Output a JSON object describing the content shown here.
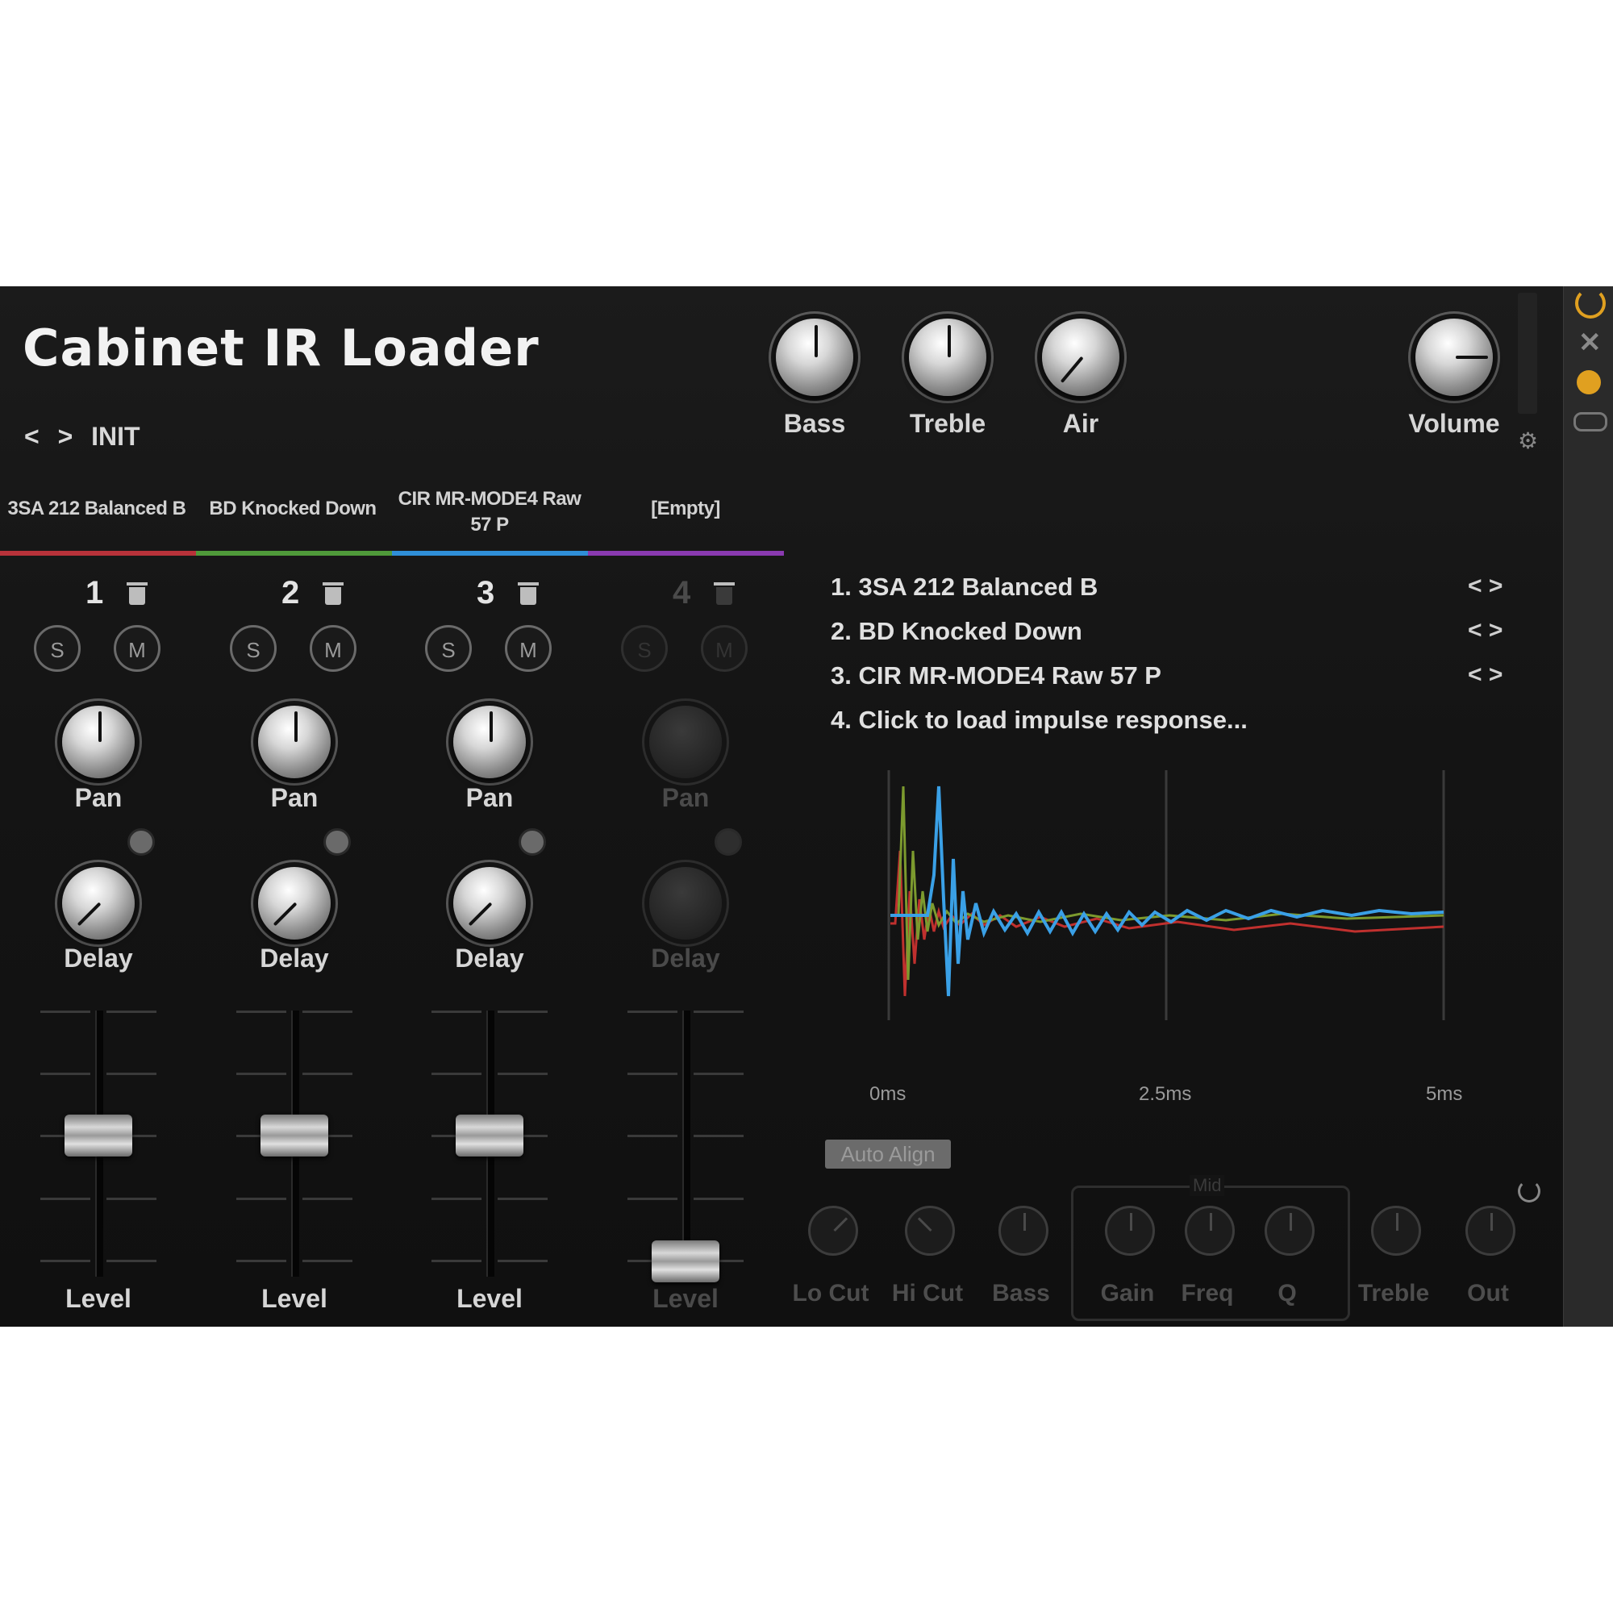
{
  "header": {
    "title": "Cabinet IR Loader",
    "preset_prev": "<",
    "preset_next": ">",
    "preset_name": "INIT"
  },
  "master_knobs": [
    {
      "label": "Bass"
    },
    {
      "label": "Treble"
    },
    {
      "label": "Air"
    },
    {
      "label": "Volume"
    }
  ],
  "tabs": [
    {
      "label": "3SA 212 Balanced B",
      "color": "#b8323a"
    },
    {
      "label": "BD Knocked Down",
      "color": "#4f9a3a"
    },
    {
      "label": "CIR MR-MODE4 Raw 57 P",
      "color": "#2f8fd8"
    },
    {
      "label": "[Empty]",
      "color": "#8a3ab0"
    }
  ],
  "channels": [
    {
      "number": "1",
      "solo": "S",
      "mute": "M",
      "pan": "Pan",
      "delay": "Delay",
      "level": "Level"
    },
    {
      "number": "2",
      "solo": "S",
      "mute": "M",
      "pan": "Pan",
      "delay": "Delay",
      "level": "Level"
    },
    {
      "number": "3",
      "solo": "S",
      "mute": "M",
      "pan": "Pan",
      "delay": "Delay",
      "level": "Level"
    },
    {
      "number": "4",
      "solo": "S",
      "mute": "M",
      "pan": "Pan",
      "delay": "Delay",
      "level": "Level"
    }
  ],
  "ir_list": [
    {
      "text": "1. 3SA 212 Balanced B",
      "arrows": "< >"
    },
    {
      "text": "2. BD Knocked Down",
      "arrows": "< >"
    },
    {
      "text": "3. CIR MR-MODE4 Raw 57 P",
      "arrows": "< >"
    },
    {
      "text": "4. Click to load impulse response...",
      "arrows": ""
    }
  ],
  "waveform": {
    "x_ticks": [
      "0ms",
      "2.5ms",
      "5ms"
    ],
    "colors": {
      "ir1": "#c0302e",
      "ir2": "#7c9a2e",
      "ir3": "#3aa0e6"
    }
  },
  "auto_align": "Auto Align",
  "eq": {
    "mid_group": "Mid",
    "bands": [
      "Lo Cut",
      "Hi Cut",
      "Bass",
      "Gain",
      "Freq",
      "Q",
      "Treble",
      "Out"
    ]
  },
  "sidebar": {
    "icons": [
      "power-icon",
      "close-icon",
      "link-icon",
      "loop-icon"
    ],
    "accent": "#e0a020"
  }
}
